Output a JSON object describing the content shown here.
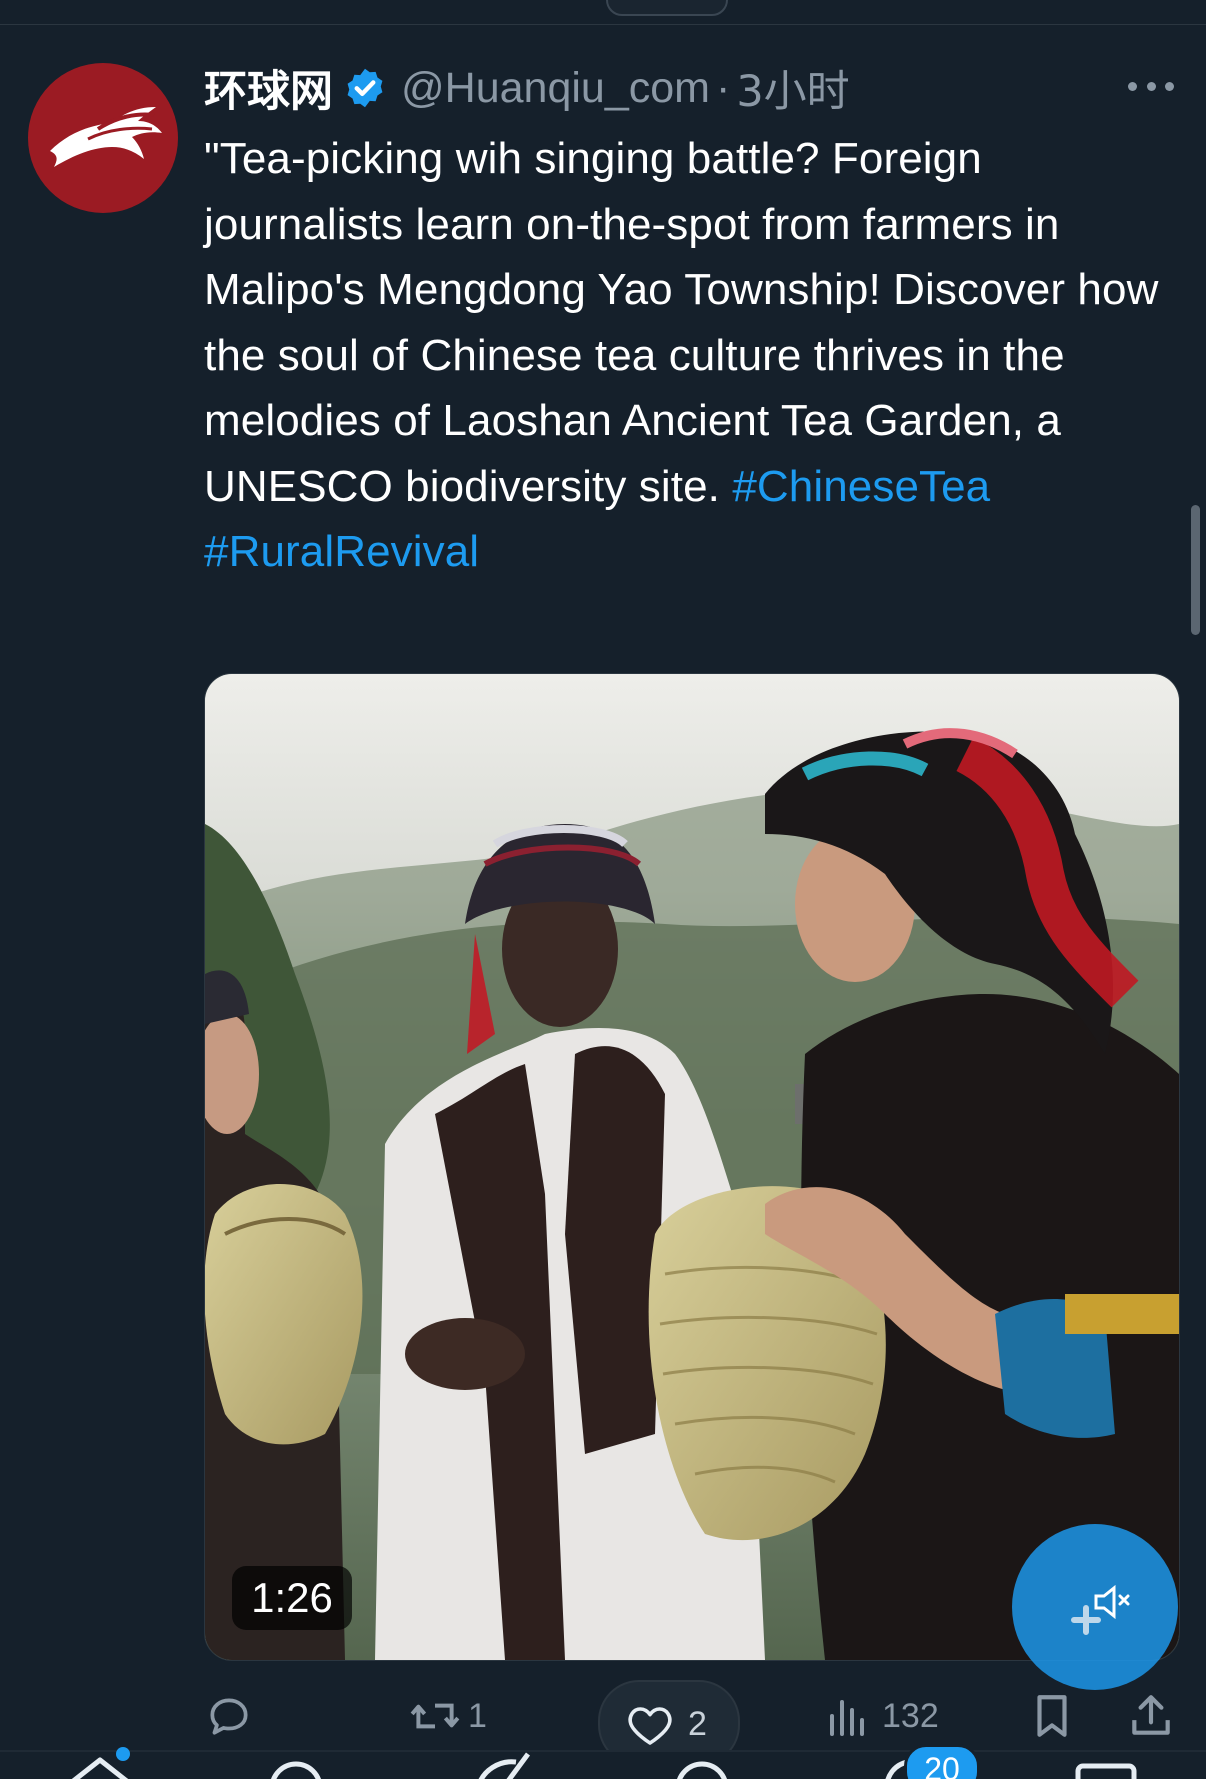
{
  "tweet": {
    "display_name": "环球网",
    "handle": "@Huanqiu_com",
    "separator": "·",
    "time": "3小时",
    "text": "\"Tea-picking wih singing battle?  Foreign journalists learn on-the-spot from farmers in Malipo's Mengdong Yao Township! Discover how the soul of Chinese tea culture thrives in the melodies of Laoshan Ancient Tea Garden, a UNESCO biodiversity site. ",
    "hashtags": [
      "#ChineseTea",
      "#RuralRevival"
    ],
    "video": {
      "duration": "1:26"
    },
    "actions": {
      "reply_count": "",
      "retweet_count": "1",
      "like_count": "2",
      "views_count": "132"
    }
  },
  "tabbar": {
    "notifications_badge": "20"
  },
  "colors": {
    "background": "#15202b",
    "accent": "#1d9bf0",
    "secondary_text": "#8b98a5",
    "avatar_red": "#9b1b23"
  },
  "icons": [
    "verified-badge-icon",
    "more-icon",
    "reply-icon",
    "retweet-icon",
    "like-icon",
    "views-icon",
    "bookmark-icon",
    "share-icon",
    "mute-icon",
    "home-icon",
    "search-icon",
    "grok-icon",
    "communities-icon",
    "notifications-icon",
    "messages-icon"
  ]
}
